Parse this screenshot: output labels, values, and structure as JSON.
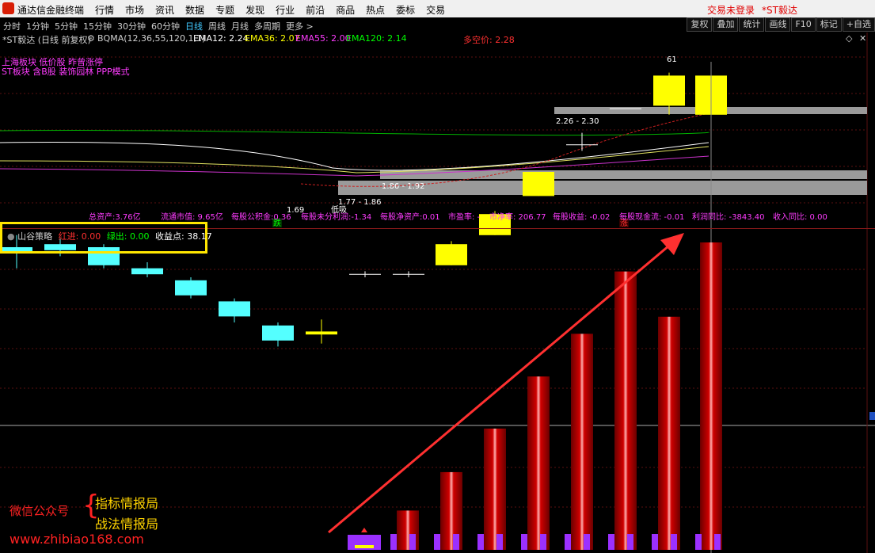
{
  "app": {
    "name": "通达信金融终端"
  },
  "menu": [
    "行情",
    "市场",
    "资讯",
    "数据",
    "专题",
    "发现",
    "行业",
    "前沿",
    "商品",
    "热点",
    "委标",
    "交易"
  ],
  "status": {
    "trade": "交易未登录",
    "stock": "*ST毅达"
  },
  "periods": [
    {
      "label": "分时",
      "active": false
    },
    {
      "label": "1分钟",
      "active": false
    },
    {
      "label": "5分钟",
      "active": false
    },
    {
      "label": "15分钟",
      "active": false
    },
    {
      "label": "30分钟",
      "active": false
    },
    {
      "label": "60分钟",
      "active": false
    },
    {
      "label": "日线",
      "active": true
    },
    {
      "label": "周线",
      "active": false
    },
    {
      "label": "月线",
      "active": false
    },
    {
      "label": "多周期",
      "active": false
    },
    {
      "label": "更多 >",
      "active": false
    }
  ],
  "tools": [
    "复权",
    "叠加",
    "统计",
    "画线",
    "F10",
    "标记",
    "+自选"
  ],
  "indicator_bar": {
    "stock_title": "*ST毅达 (日线 前复权)",
    "bqma": "BQMA(12,36,55,120,1,1)",
    "ema12": "EMA12: 2.24",
    "ema36": "EMA36: 2.07",
    "ema55": "EMA55: 2.00",
    "ema120": "EMA120: 2.14",
    "multi_price": "多空价: 2.28"
  },
  "annotations": [
    "上海板块 低价股 昨曾涨停",
    "ST板块 含B股 装饰园林 PPP模式"
  ],
  "price_labels": {
    "zone_top": "2.26 - 2.30",
    "zone_mid": "1.86 - 1.92",
    "zone_low": "1.77 - 1.86",
    "low_val": "1.69",
    "low_tag": "低吸",
    "high_val": "61"
  },
  "fundamentals": {
    "f0": "总资产:3.76亿",
    "f1": "流通市值: 9.65亿",
    "f2": "每股公积金:0.36",
    "f3": "每股未分利润:-1.34",
    "f4": "每股净资产:0.01",
    "f5": "市盈率: -",
    "f6": "市净率: 206.77",
    "f7": "每股收益: -0.02",
    "f8": "每股现金流: -0.01",
    "f9": "利润同比: -3843.40",
    "f10": "收入同比: 0.00"
  },
  "tags": {
    "down": "跌",
    "up": "涨"
  },
  "sub_indicator": {
    "name": "山谷策略",
    "red_in": "红进: 0.00",
    "green_out": "绿出: 0.00",
    "profit": "收益点: 38.17"
  },
  "watermark": {
    "wechat": "微信公众号",
    "line1": "指标情报局",
    "line2": "战法情报局",
    "site": "www.zhibiao168.com"
  },
  "colors": {
    "up_candle": "#ffff00",
    "down_candle": "#54ffff",
    "red_bar": "#c80000",
    "purple": "#9b30ff",
    "arrow": "#ff3030"
  },
  "candles": [
    {
      "o": 2.02,
      "c": 2.0,
      "h": 2.06,
      "l": 1.95
    },
    {
      "o": 2.03,
      "c": 2.01,
      "h": 2.05,
      "l": 1.99
    },
    {
      "o": 2.02,
      "c": 1.96,
      "h": 2.03,
      "l": 1.95
    },
    {
      "o": 1.95,
      "c": 1.93,
      "h": 1.97,
      "l": 1.92
    },
    {
      "o": 1.91,
      "c": 1.86,
      "h": 1.92,
      "l": 1.85
    },
    {
      "o": 1.84,
      "c": 1.79,
      "h": 1.85,
      "l": 1.77
    },
    {
      "o": 1.76,
      "c": 1.71,
      "h": 1.77,
      "l": 1.69
    },
    {
      "o": 1.73,
      "c": 1.74,
      "h": 1.78,
      "l": 1.7
    },
    {
      "o": 1.93,
      "c": 1.93,
      "h": 1.94,
      "l": 1.92
    },
    {
      "o": 1.93,
      "c": 1.93,
      "h": 1.94,
      "l": 1.92
    },
    {
      "o": 1.96,
      "c": 2.03,
      "h": 2.04,
      "l": 1.96
    },
    {
      "o": 2.06,
      "c": 2.13,
      "h": 2.14,
      "l": 2.06
    },
    {
      "o": 2.19,
      "c": 2.27,
      "h": 2.27,
      "l": 2.19
    },
    {
      "o": 2.36,
      "c": 2.36,
      "h": 2.4,
      "l": 2.34
    },
    {
      "o": 2.48,
      "c": 2.48,
      "h": 2.48,
      "l": 2.48
    },
    {
      "o": 2.49,
      "c": 2.59,
      "h": 2.6,
      "l": 2.46
    },
    {
      "o": 2.46,
      "c": 2.59,
      "h": 2.6,
      "l": 2.46
    }
  ],
  "red_bars": [
    4.6,
    9.1,
    14.2,
    20.3,
    25.3,
    32.6,
    27.3,
    36.0
  ],
  "purple_marks": 9
}
